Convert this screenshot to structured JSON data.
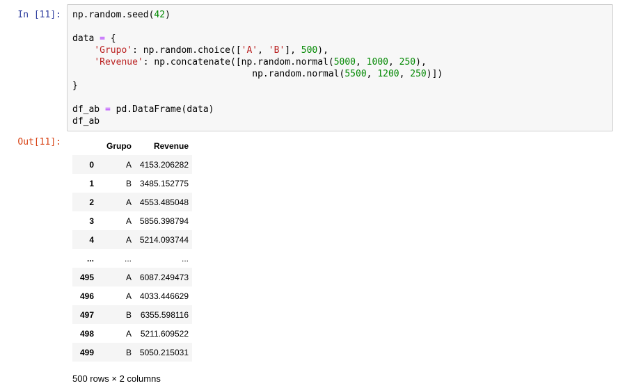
{
  "input_prompt": "In [11]:",
  "output_prompt": "Out[11]:",
  "code": {
    "line1": {
      "a": "np.random.seed(",
      "b": "42",
      "c": ")"
    },
    "line3": {
      "a": "data ",
      "op": "=",
      "b": " {"
    },
    "line4": {
      "indent": "    ",
      "s1": "'Grupo'",
      "a": ": np.random.choice([",
      "s2": "'A'",
      "b": ", ",
      "s3": "'B'",
      "c": "], ",
      "n1": "500",
      "d": "),"
    },
    "line5": {
      "indent": "    ",
      "s1": "'Revenue'",
      "a": ": np.concatenate([np.random.normal(",
      "n1": "5000",
      "b": ", ",
      "n2": "1000",
      "c": ", ",
      "n3": "250",
      "d": "),"
    },
    "line6": {
      "indent": "                                 ",
      "a": "np.random.normal(",
      "n1": "5500",
      "b": ", ",
      "n2": "1200",
      "c": ", ",
      "n3": "250",
      "d": ")])"
    },
    "line7": "}",
    "line9": {
      "a": "df_ab ",
      "op": "=",
      "b": " pd.DataFrame(data)"
    },
    "line10": "df_ab"
  },
  "dataframe": {
    "columns": [
      "Grupo",
      "Revenue"
    ],
    "rows": [
      {
        "index": "0",
        "grupo": "A",
        "revenue": "4153.206282"
      },
      {
        "index": "1",
        "grupo": "B",
        "revenue": "3485.152775"
      },
      {
        "index": "2",
        "grupo": "A",
        "revenue": "4553.485048"
      },
      {
        "index": "3",
        "grupo": "A",
        "revenue": "5856.398794"
      },
      {
        "index": "4",
        "grupo": "A",
        "revenue": "5214.093744"
      },
      {
        "index": "...",
        "grupo": "...",
        "revenue": "..."
      },
      {
        "index": "495",
        "grupo": "A",
        "revenue": "6087.249473"
      },
      {
        "index": "496",
        "grupo": "A",
        "revenue": "4033.446629"
      },
      {
        "index": "497",
        "grupo": "B",
        "revenue": "6355.598116"
      },
      {
        "index": "498",
        "grupo": "A",
        "revenue": "5211.609522"
      },
      {
        "index": "499",
        "grupo": "B",
        "revenue": "5050.215031"
      }
    ],
    "shape_text": "500 rows × 2 columns"
  },
  "colors": {
    "input_prompt": "#303f9f",
    "output_prompt": "#d84315",
    "operator": "#aa22ff",
    "number": "#008800",
    "string": "#ba2121"
  }
}
